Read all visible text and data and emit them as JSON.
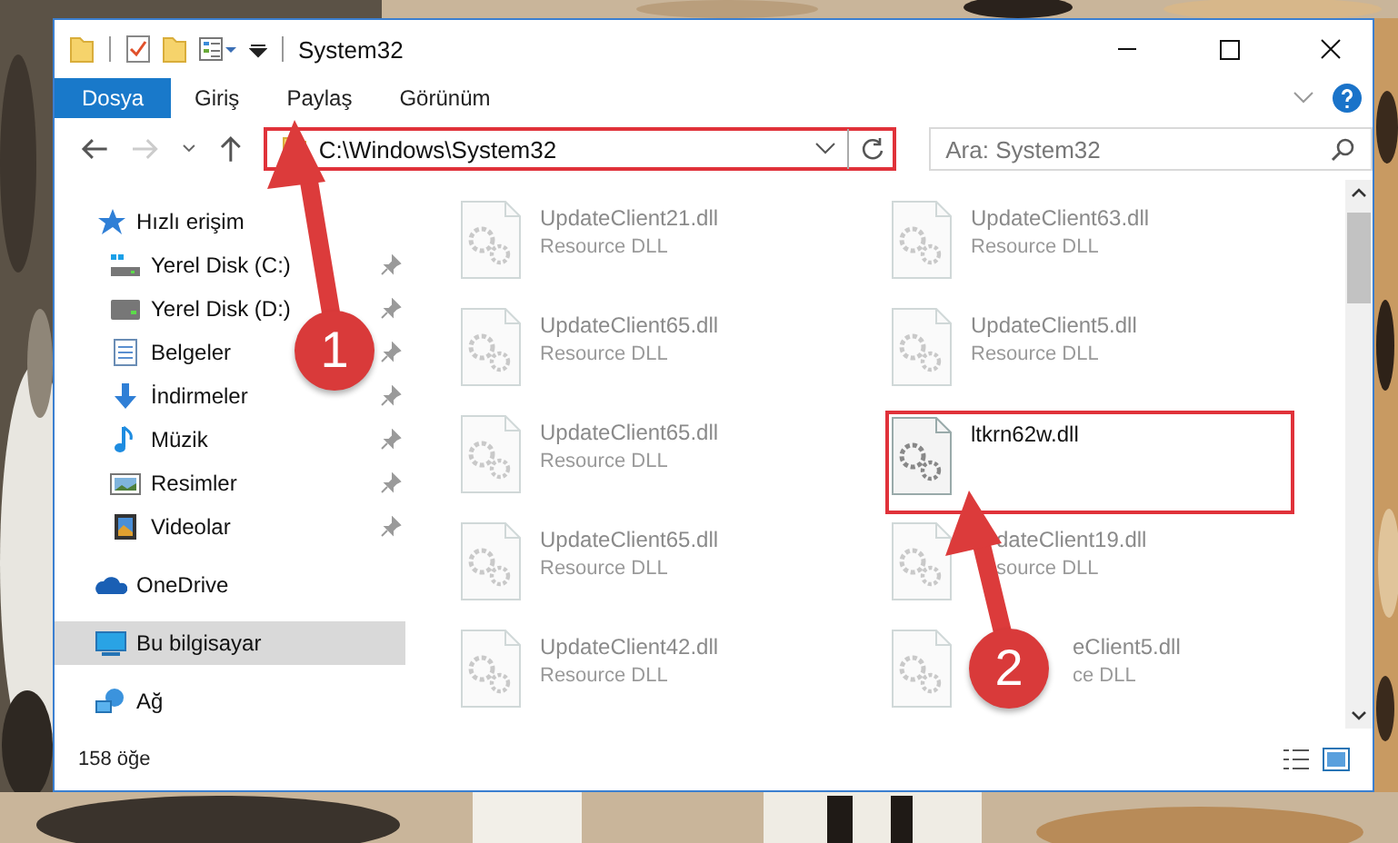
{
  "window": {
    "title": "System32"
  },
  "ribbon_tabs": [
    {
      "label": "Dosya",
      "selected": true
    },
    {
      "label": "Giriş",
      "selected": false
    },
    {
      "label": "Paylaş",
      "selected": false
    },
    {
      "label": "Görünüm",
      "selected": false
    }
  ],
  "address": {
    "path": "C:\\Windows\\System32",
    "highlighted": true
  },
  "search": {
    "placeholder": "Ara: System32"
  },
  "sidebar": {
    "items": [
      {
        "label": "Hızlı erişim",
        "kind": "star",
        "selected": false,
        "children": [
          {
            "label": "Yerel Disk (C:)",
            "kind": "drive-c",
            "pinned": true,
            "selected": false
          },
          {
            "label": "Yerel Disk (D:)",
            "kind": "drive",
            "pinned": true,
            "selected": false
          },
          {
            "label": "Belgeler",
            "kind": "documents",
            "pinned": true,
            "selected": false
          },
          {
            "label": "İndirmeler",
            "kind": "downloads",
            "pinned": true,
            "selected": false
          },
          {
            "label": "Müzik",
            "kind": "music",
            "pinned": true,
            "selected": false
          },
          {
            "label": "Resimler",
            "kind": "pictures",
            "pinned": true,
            "selected": false
          },
          {
            "label": "Videolar",
            "kind": "videos",
            "pinned": true,
            "selected": false
          }
        ]
      },
      {
        "label": "OneDrive",
        "kind": "cloud",
        "selected": false
      },
      {
        "label": "Bu bilgisayar",
        "kind": "computer",
        "selected": true
      },
      {
        "label": "Ağ",
        "kind": "network",
        "selected": false
      }
    ]
  },
  "files": [
    {
      "kind": "plain",
      "name": "UpdateClient21.dll",
      "type": "Resource DLL",
      "blurred": true,
      "highlighted": false
    },
    {
      "kind": "plain",
      "name": "UpdateClient63.dll",
      "type": "Resource DLL",
      "blurred": true,
      "highlighted": false
    },
    {
      "kind": "plain",
      "name": "UpdateClient65.dll",
      "type": "Resource DLL",
      "blurred": true,
      "highlighted": false
    },
    {
      "kind": "plain",
      "name": "UpdateClient5.dll",
      "type": "Resource DLL",
      "blurred": true,
      "highlighted": false
    },
    {
      "kind": "plain",
      "name": "UpdateClient65.dll",
      "type": "Resource DLL",
      "blurred": true,
      "highlighted": false
    },
    {
      "kind": "plain",
      "name": "ltkrn62w.dll",
      "blurred": false,
      "highlighted": true
    },
    {
      "kind": "plain",
      "name": "UpdateClient65.dll",
      "type": "Resource DLL",
      "blurred": true,
      "highlighted": false
    },
    {
      "kind": "arrowed",
      "name": "dateClient19.dll",
      "type": "source DLL",
      "blurred": true,
      "highlighted": false
    },
    {
      "kind": "plain",
      "name": "UpdateClient42.dll",
      "type": "Resource DLL",
      "blurred": true,
      "highlighted": false
    },
    {
      "kind": "badged",
      "name": "eClient5.dll",
      "type": "ce DLL",
      "blurred": true,
      "highlighted": false
    }
  ],
  "status_bar": {
    "count": "158 öğe"
  },
  "annotations": [
    {
      "label": "1"
    },
    {
      "label": "2"
    }
  ]
}
